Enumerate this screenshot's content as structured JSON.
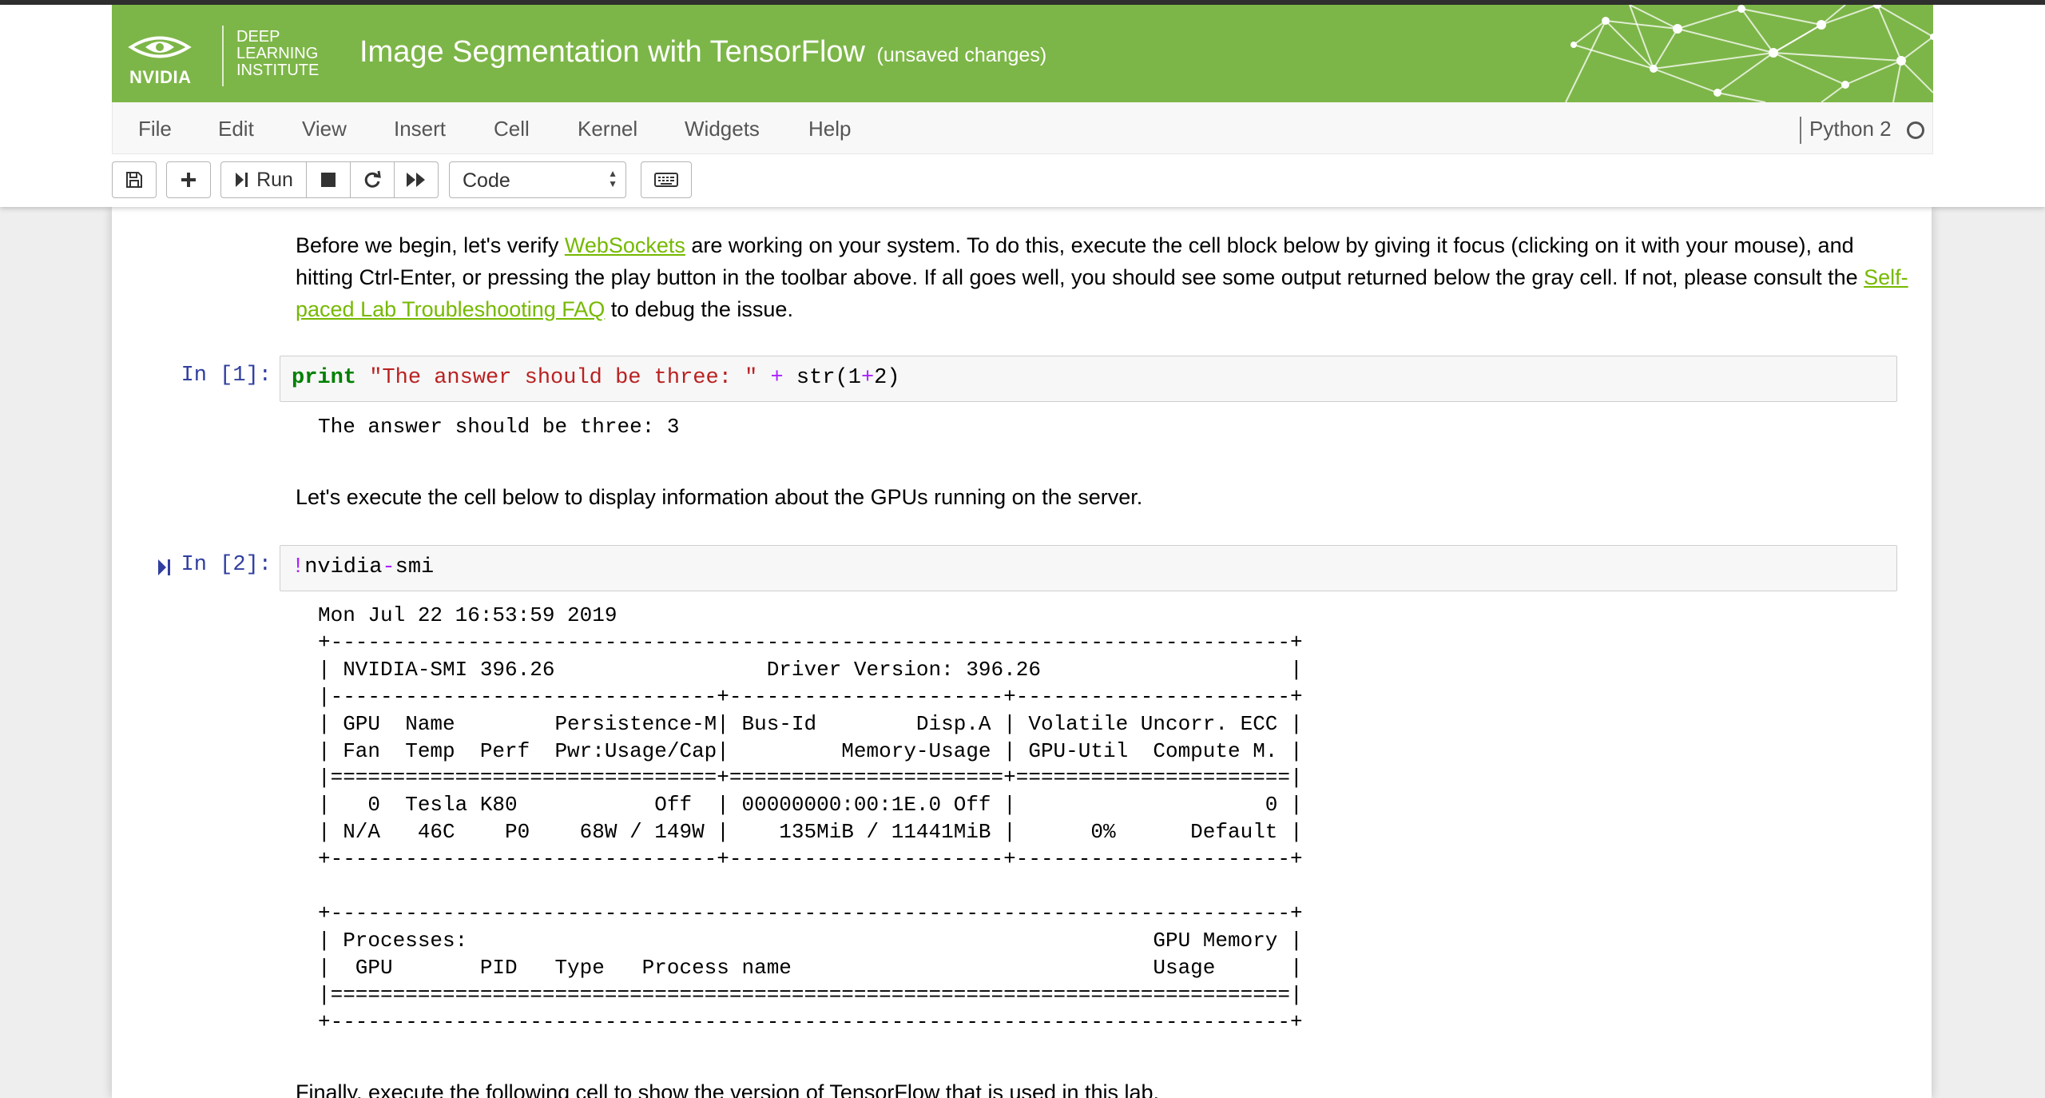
{
  "window": {
    "title": "Image Segmentation with TensorFlow",
    "subtitle": "(unsaved changes)"
  },
  "logo": {
    "brand": "NVIDIA",
    "lines": [
      "DEEP",
      "LEARNING",
      "INSTITUTE"
    ]
  },
  "menu": [
    "File",
    "Edit",
    "View",
    "Insert",
    "Cell",
    "Kernel",
    "Widgets",
    "Help"
  ],
  "kernel": {
    "name": "Python 2"
  },
  "toolbar": {
    "run_label": "Run",
    "cell_type": "Code",
    "icons": [
      "save-icon",
      "plus-icon",
      "step-forward-icon",
      "stop-icon",
      "restart-icon",
      "fast-forward-icon",
      "keyboard-icon"
    ]
  },
  "cells": {
    "intro": {
      "t1": "Before we begin, let's verify ",
      "link1": "WebSockets",
      "t2": " are working on your system. To do this, execute the cell block below by giving it focus (clicking on it with your mouse), and hitting Ctrl-Enter, or pressing the play button in the toolbar above. If all goes well, you should see some output returned below the gray cell. If not, please consult the ",
      "link2": "Self-paced Lab Troubleshooting FAQ",
      "t3": " to debug the issue."
    },
    "cell1": {
      "prompt": "In [1]:",
      "code_kw": "print",
      "code_str": "\"The answer should be three: \"",
      "code_op": "+",
      "code_func": "str",
      "code_num1": "1",
      "code_plus": "+",
      "code_num2": "2",
      "output": "The answer should be three: 3"
    },
    "md2": "Let's execute the cell below to display information about the GPUs running on the server.",
    "cell2": {
      "prompt": "In [2]:",
      "code_bang": "!",
      "code_a": "nvidia",
      "code_dash": "-",
      "code_b": "smi",
      "output": "Mon Jul 22 16:53:59 2019       \n+-----------------------------------------------------------------------------+\n| NVIDIA-SMI 396.26                 Driver Version: 396.26                    |\n|-------------------------------+----------------------+----------------------+\n| GPU  Name        Persistence-M| Bus-Id        Disp.A | Volatile Uncorr. ECC |\n| Fan  Temp  Perf  Pwr:Usage/Cap|         Memory-Usage | GPU-Util  Compute M. |\n|===============================+======================+======================|\n|   0  Tesla K80           Off  | 00000000:00:1E.0 Off |                    0 |\n| N/A   46C    P0    68W / 149W |    135MiB / 11441MiB |      0%      Default |\n+-------------------------------+----------------------+----------------------+\n                                                                               \n+-----------------------------------------------------------------------------+\n| Processes:                                                       GPU Memory |\n|  GPU       PID   Type   Process name                             Usage      |\n|=============================================================================|\n+-----------------------------------------------------------------------------+"
    },
    "md3": "Finally, execute the following cell to show the version of TensorFlow that is used in this lab."
  }
}
